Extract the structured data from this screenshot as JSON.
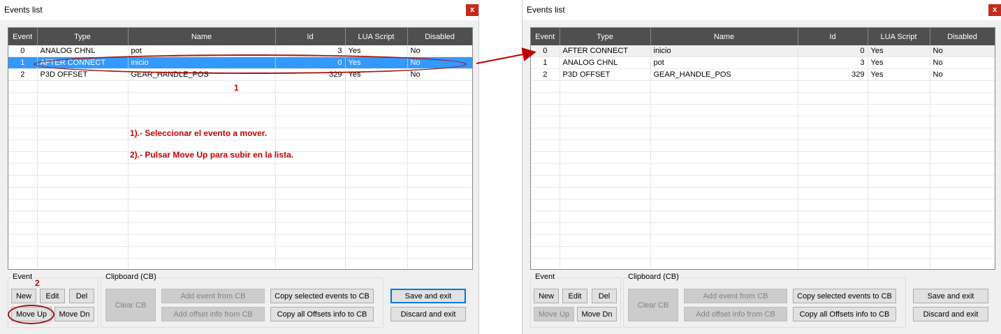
{
  "window": {
    "title": "Events list",
    "close_label": "x"
  },
  "columns": [
    "Event",
    "Type",
    "Name",
    "Id",
    "LUA Script",
    "Disabled"
  ],
  "left_rows": [
    {
      "event": "0",
      "type": "ANALOG CHNL",
      "name": "pot",
      "id": "3",
      "lua": "Yes",
      "disabled": "No"
    },
    {
      "event": "1",
      "type": "AFTER CONNECT",
      "name": "inicio",
      "id": "0",
      "lua": "Yes",
      "disabled": "No"
    },
    {
      "event": "2",
      "type": "P3D OFFSET",
      "name": "GEAR_HANDLE_POS",
      "id": "329",
      "lua": "Yes",
      "disabled": "No"
    }
  ],
  "right_rows": [
    {
      "event": "0",
      "type": "AFTER CONNECT",
      "name": "inicio",
      "id": "0",
      "lua": "Yes",
      "disabled": "No"
    },
    {
      "event": "1",
      "type": "ANALOG CHNL",
      "name": "pot",
      "id": "3",
      "lua": "Yes",
      "disabled": "No"
    },
    {
      "event": "2",
      "type": "P3D OFFSET",
      "name": "GEAR_HANDLE_POS",
      "id": "329",
      "lua": "Yes",
      "disabled": "No"
    }
  ],
  "groups": {
    "event": "Event",
    "clipboard": "Clipboard (CB)"
  },
  "buttons": {
    "new": "New",
    "edit": "Edit",
    "del": "Del",
    "move_up": "Move Up",
    "move_dn": "Move Dn",
    "clear_cb": "Clear CB",
    "add_event_cb": "Add event from CB",
    "add_offset_cb": "Add offset info from CB",
    "copy_selected": "Copy selected events to CB",
    "copy_all_offsets": "Copy all Offsets info to CB",
    "save_exit": "Save and exit",
    "discard_exit": "Discard and exit"
  },
  "annotations": {
    "step1_marker": "1",
    "step2_marker": "2",
    "instruction1": "1).- Seleccionar el evento a mover.",
    "instruction2": "2).- Pulsar Move Up para subir en la lista."
  },
  "colors": {
    "selection": "#3399ff",
    "annotation": "#c00000",
    "header": "#4f4f4f",
    "close": "#c42b1c"
  }
}
